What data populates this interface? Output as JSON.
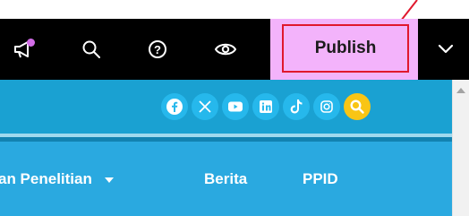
{
  "toolbar": {
    "icons": [
      {
        "name": "megaphone-icon"
      },
      {
        "name": "search-icon"
      },
      {
        "name": "help-icon",
        "label": "?"
      },
      {
        "name": "preview-eye-icon"
      }
    ],
    "publish_label": "Publish",
    "more_icon": "chevron-down-icon"
  },
  "colors": {
    "toolbar_bg": "#000000",
    "publish_zone_bg": "#f3b3fb",
    "publish_border": "#e0182d",
    "notification_dot": "#d36de8",
    "annotation_arrow": "#e0182d",
    "social_bar_bg": "#1aa1d2",
    "nav_bar_bg": "#2aa9e0",
    "social_icon_bg": "#26b8ec",
    "search_button_bg": "#f9c515"
  },
  "social_icons": [
    {
      "name": "facebook-icon"
    },
    {
      "name": "x-twitter-icon"
    },
    {
      "name": "youtube-icon"
    },
    {
      "name": "linkedin-icon"
    },
    {
      "name": "tiktok-icon"
    },
    {
      "name": "instagram-icon"
    },
    {
      "name": "search-icon"
    }
  ],
  "nav": {
    "items": [
      {
        "label": "an Penelitian",
        "has_dropdown": true
      },
      {
        "label": "Berita",
        "has_dropdown": false
      },
      {
        "label": "PPID",
        "has_dropdown": false
      }
    ]
  },
  "annotation": {
    "type": "arrow",
    "points_to": "publish-button"
  }
}
